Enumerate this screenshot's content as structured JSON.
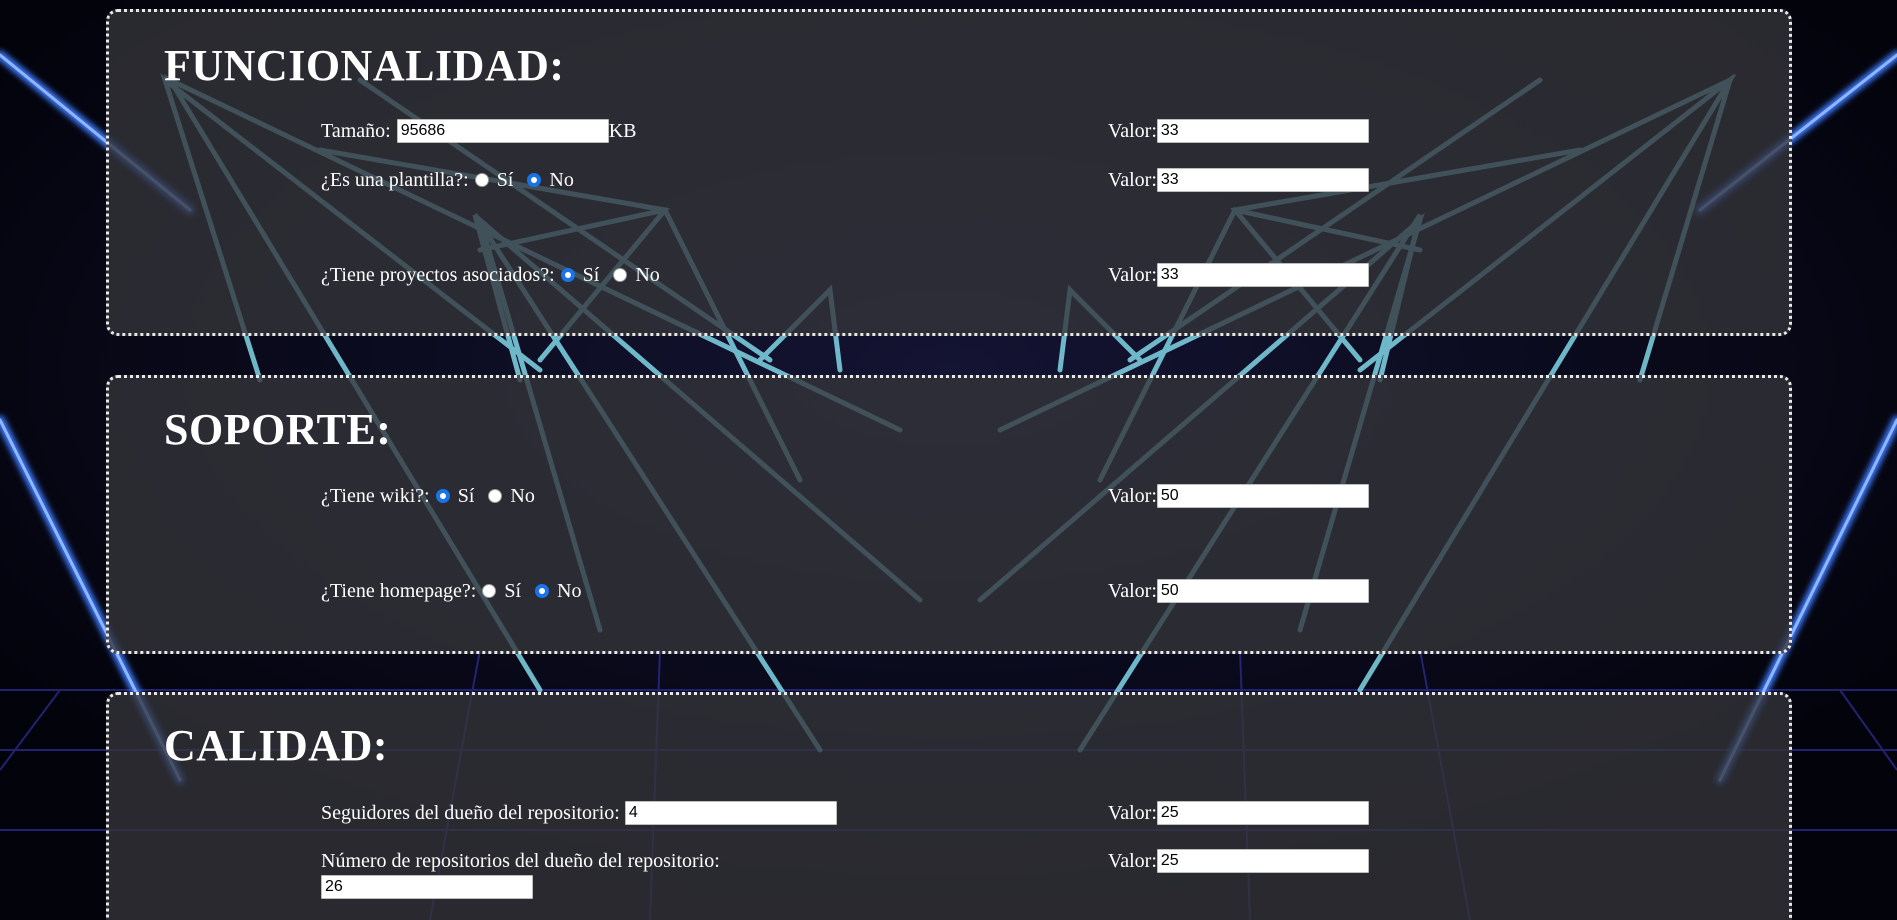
{
  "funcionalidad": {
    "title": "FUNCIONALIDAD:",
    "tamano": {
      "label": "Tamaño:",
      "value": "95686",
      "unit": "KB",
      "valor_label": "Valor:",
      "valor": "33"
    },
    "plantilla": {
      "label": "¿Es una plantilla?:",
      "opt_si": "Sí",
      "opt_no": "No",
      "selected": "No",
      "valor_label": "Valor:",
      "valor": "33"
    },
    "proyectos": {
      "label": "¿Tiene proyectos asociados?:",
      "opt_si": "Sí",
      "opt_no": "No",
      "selected": "Sí",
      "valor_label": "Valor:",
      "valor": "33"
    }
  },
  "soporte": {
    "title": "SOPORTE:",
    "wiki": {
      "label": "¿Tiene wiki?:",
      "opt_si": "Sí",
      "opt_no": "No",
      "selected": "Sí",
      "valor_label": "Valor:",
      "valor": "50"
    },
    "homepage": {
      "label": "¿Tiene homepage?:",
      "opt_si": "Sí",
      "opt_no": "No",
      "selected": "No",
      "valor_label": "Valor:",
      "valor": "50"
    }
  },
  "calidad": {
    "title": "CALIDAD:",
    "seguidores": {
      "label": "Seguidores del dueño del repositorio:",
      "value": "4",
      "valor_label": "Valor:",
      "valor": "25"
    },
    "num_repos": {
      "label": "Número de repositorios del dueño del repositorio:",
      "value": "26",
      "valor_label": "Valor:",
      "valor": "25"
    }
  },
  "colors": {
    "panel": "#34343a",
    "border": "#e8e8e8",
    "radio_accent": "#1a73e8",
    "neon_blue": "#3d7bff",
    "neon_cyan": "#7fd6e6"
  }
}
